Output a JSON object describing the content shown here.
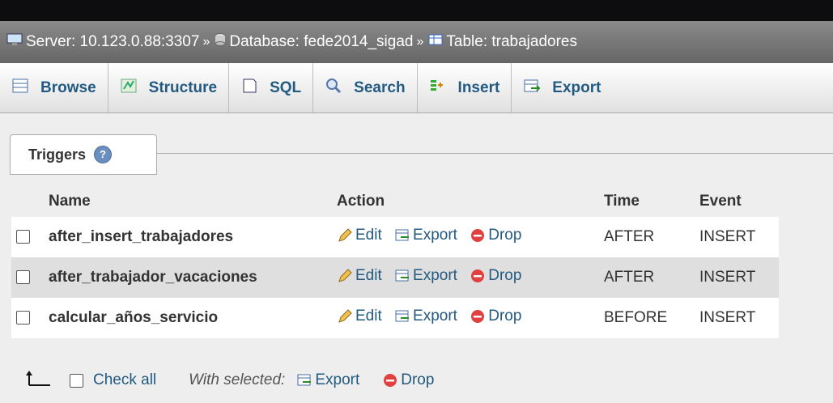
{
  "breadcrumb": {
    "server": "Server: 10.123.0.88:3307",
    "database": "Database: fede2014_sigad",
    "table": "Table: trabajadores",
    "separator": "»"
  },
  "tabs": [
    {
      "label": "Browse",
      "icon": "browse-icon"
    },
    {
      "label": "Structure",
      "icon": "structure-icon"
    },
    {
      "label": "SQL",
      "icon": "sql-icon"
    },
    {
      "label": "Search",
      "icon": "search-icon"
    },
    {
      "label": "Insert",
      "icon": "insert-icon"
    },
    {
      "label": "Export",
      "icon": "export-icon"
    }
  ],
  "section": {
    "title": "Triggers",
    "help_glyph": "?"
  },
  "table": {
    "headers": {
      "name": "Name",
      "action": "Action",
      "time": "Time",
      "event": "Event"
    },
    "rows": [
      {
        "name": "after_insert_trabajadores",
        "edit": "Edit",
        "export": "Export",
        "drop": "Drop",
        "time": "AFTER",
        "event": "INSERT"
      },
      {
        "name": "after_trabajador_vacaciones",
        "edit": "Edit",
        "export": "Export",
        "drop": "Drop",
        "time": "AFTER",
        "event": "INSERT"
      },
      {
        "name": "calcular_años_servicio",
        "edit": "Edit",
        "export": "Export",
        "drop": "Drop",
        "time": "BEFORE",
        "event": "INSERT"
      }
    ]
  },
  "footer": {
    "check_all": "Check all",
    "with_selected": "With selected:",
    "export": "Export",
    "drop": "Drop"
  },
  "colors": {
    "link": "#235a81",
    "breadcrumb_bg": "#777777",
    "drop_red": "#e0413f"
  }
}
